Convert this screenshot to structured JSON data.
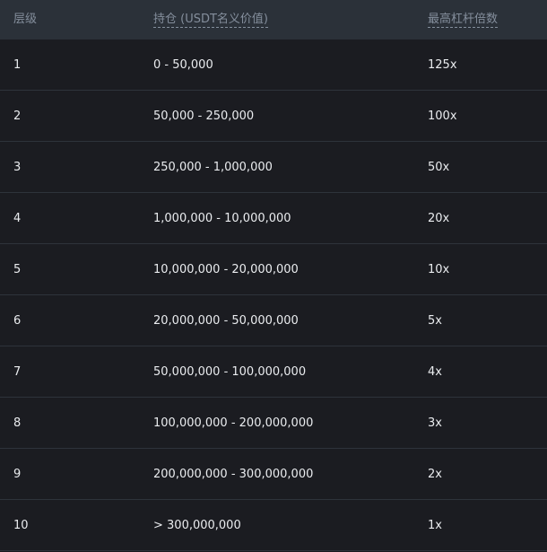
{
  "header": {
    "tier": "层级",
    "position": "持仓 (USDT名义价值)",
    "leverage": "最高杠杆倍数"
  },
  "rows": [
    {
      "tier": "1",
      "position": "0 - 50,000",
      "leverage": "125x"
    },
    {
      "tier": "2",
      "position": "50,000 - 250,000",
      "leverage": "100x"
    },
    {
      "tier": "3",
      "position": "250,000 - 1,000,000",
      "leverage": "50x"
    },
    {
      "tier": "4",
      "position": "1,000,000 - 10,000,000",
      "leverage": "20x"
    },
    {
      "tier": "5",
      "position": "10,000,000 - 20,000,000",
      "leverage": "10x"
    },
    {
      "tier": "6",
      "position": "20,000,000 - 50,000,000",
      "leverage": "5x"
    },
    {
      "tier": "7",
      "position": "50,000,000 - 100,000,000",
      "leverage": "4x"
    },
    {
      "tier": "8",
      "position": "100,000,000 - 200,000,000",
      "leverage": "3x"
    },
    {
      "tier": "9",
      "position": "200,000,000 - 300,000,000",
      "leverage": "2x"
    },
    {
      "tier": "10",
      "position": "> 300,000,000",
      "leverage": "1x"
    }
  ],
  "colors": {
    "background": "#1b1c21",
    "header_bg": "#2b3139",
    "text": "#eaecef",
    "muted": "#848e9c"
  }
}
